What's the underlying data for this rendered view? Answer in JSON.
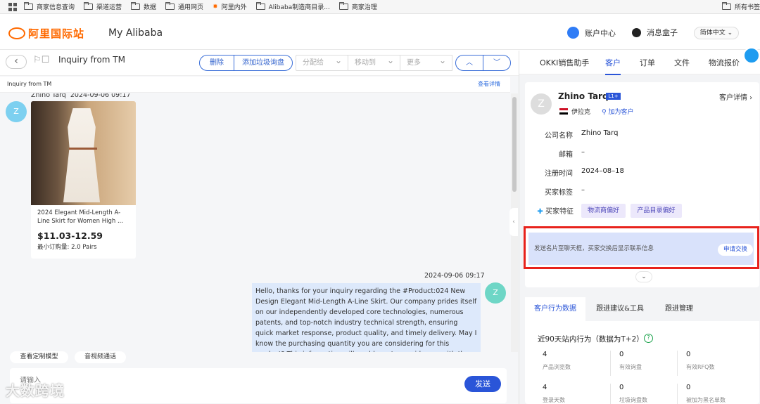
{
  "bookmarks": [
    "商家信息查询",
    "渠道运营",
    "数据",
    "通用网页",
    "阿里内外",
    "Alibaba制造商目录...",
    "商家治理"
  ],
  "bookmarks_right": "所有书签",
  "header": {
    "logo": "阿里国际站",
    "my": "My Alibaba",
    "account": "账户中心",
    "inbox": "消息盒子",
    "lang": "简体中文"
  },
  "toolbar": {
    "title": "Inquiry from TM",
    "delete": "删除",
    "add_spam": "添加垃圾询盘",
    "assign": "分配给",
    "move": "移动到",
    "more": "更多",
    "up": "︿",
    "down": "﹀"
  },
  "subbar": {
    "label": "Inquiry from TM",
    "details": "查看详情"
  },
  "chat": {
    "sender": "Zhino Tarq",
    "sender_time": "2024-09-06 09:17",
    "avatar": "Z",
    "product": {
      "name": "2024 Elegant Mid-Length A-Line Skirt for Women High ...",
      "price": "$11.03-12.59",
      "moq": "最小订购量: 2.0 Pairs"
    },
    "reply_time": "2024-09-06 09:17",
    "reply": "Hello, thanks for your inquiry regarding the #Product:024 New Design Elegant Mid-Length A-Line Skirt. Our company prides itself on our independently developed core technologies, numerous patents, and top-notch industry technical strength, ensuring quick market response, product quality, and timely delivery. May I know the purchasing quantity you are considering for this product? This information will enable us to provide you with the most accurate",
    "my_avatar": "Z"
  },
  "actions": {
    "custom": "查看定制模型",
    "video": "音视频通话"
  },
  "input": {
    "placeholder": "请输入",
    "send": "发送"
  },
  "watermark": "大数跨境",
  "rtabs": [
    "OKKI销售助手",
    "客户",
    "订单",
    "文件",
    "物流报价"
  ],
  "customer": {
    "name": "Zhino Tarq",
    "level": "L1+",
    "detail": "客户详情 ›",
    "country": "伊拉克",
    "add": "加为客户",
    "fields": [
      {
        "label": "公司名称",
        "value": "Zhino Tarq"
      },
      {
        "label": "邮箱",
        "value": "–"
      },
      {
        "label": "注册时间",
        "value": "2024–08–18"
      },
      {
        "label": "买家标签",
        "value": "–"
      }
    ],
    "feature_label": "买家特征",
    "tags": [
      "物流商偏好",
      "产品目录偏好"
    ],
    "banner": "发送名片至聊天框，买家交换后显示联系信息",
    "apply": "申请交换"
  },
  "btabs": [
    "客户行为数据",
    "跟进建议&工具",
    "跟进管理"
  ],
  "stats": {
    "title": "近90天站内行为（数据为T+2）",
    "row1": [
      {
        "n": "4",
        "l": "产品浏览数"
      },
      {
        "n": "0",
        "l": "有效询盘"
      },
      {
        "n": "0",
        "l": "有效RFQ数"
      }
    ],
    "row2": [
      {
        "n": "4",
        "l": "登录天数"
      },
      {
        "n": "0",
        "l": "垃圾询盘数"
      },
      {
        "n": "0",
        "l": "被加为黑名单数"
      }
    ]
  },
  "colors": {
    "accent": "#2a55d8",
    "brand": "#ff6a00",
    "highlight": "#e8221c"
  }
}
